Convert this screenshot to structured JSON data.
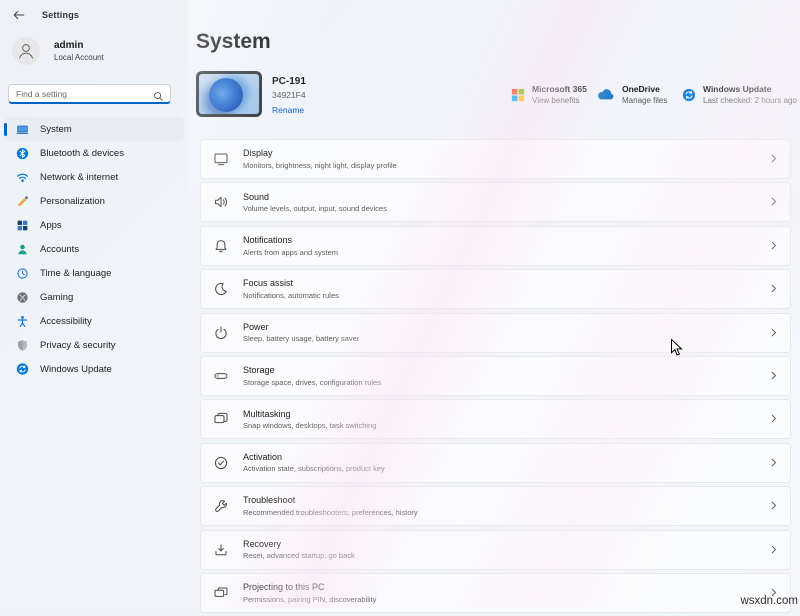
{
  "titlebar": {
    "title": "Settings",
    "back_icon": "back-arrow-icon"
  },
  "user": {
    "name": "admin",
    "type": "Local Account",
    "avatar_icon": "person-icon"
  },
  "search": {
    "placeholder": "Find a setting",
    "icon": "search-icon"
  },
  "sidebar": {
    "items": [
      {
        "id": "system",
        "label": "System",
        "icon": "system-icon",
        "selected": true
      },
      {
        "id": "bluetooth-devices",
        "label": "Bluetooth & devices",
        "icon": "bluetooth-icon",
        "selected": false
      },
      {
        "id": "network-internet",
        "label": "Network & internet",
        "icon": "network-icon",
        "selected": false
      },
      {
        "id": "personalization",
        "label": "Personalization",
        "icon": "personalization-icon",
        "selected": false
      },
      {
        "id": "apps",
        "label": "Apps",
        "icon": "apps-icon",
        "selected": false
      },
      {
        "id": "accounts",
        "label": "Accounts",
        "icon": "accounts-icon",
        "selected": false
      },
      {
        "id": "time-language",
        "label": "Time & language",
        "icon": "time-language-icon",
        "selected": false
      },
      {
        "id": "gaming",
        "label": "Gaming",
        "icon": "gaming-icon",
        "selected": false
      },
      {
        "id": "accessibility",
        "label": "Accessibility",
        "icon": "accessibility-icon",
        "selected": false
      },
      {
        "id": "privacy-security",
        "label": "Privacy & security",
        "icon": "privacy-security-icon",
        "selected": false
      },
      {
        "id": "windows-update",
        "label": "Windows Update",
        "icon": "windows-update-icon",
        "selected": false
      }
    ]
  },
  "page": {
    "title": "System"
  },
  "device": {
    "name": "PC-191",
    "id": "34921F4",
    "rename_label": "Rename"
  },
  "quick_links": [
    {
      "title": "Microsoft 365",
      "subtitle": "View benefits",
      "icon": "microsoft-365-icon"
    },
    {
      "title": "OneDrive",
      "subtitle": "Manage files",
      "icon": "onedrive-icon"
    },
    {
      "title": "Windows Update",
      "subtitle": "Last checked: 2 hours ago",
      "icon": "windows-update-icon"
    }
  ],
  "settings_rows": [
    {
      "id": "display",
      "title": "Display",
      "subtitle": "Monitors, brightness, night light, display profile",
      "icon": "display-icon"
    },
    {
      "id": "sound",
      "title": "Sound",
      "subtitle": "Volume levels, output, input, sound devices",
      "icon": "sound-icon"
    },
    {
      "id": "notifications",
      "title": "Notifications",
      "subtitle": "Alerts from apps and system",
      "icon": "notifications-icon"
    },
    {
      "id": "focus-assist",
      "title": "Focus assist",
      "subtitle": "Notifications, automatic rules",
      "icon": "focus-assist-icon"
    },
    {
      "id": "power",
      "title": "Power",
      "subtitle": "Sleep, battery usage, battery saver",
      "icon": "power-icon"
    },
    {
      "id": "storage",
      "title": "Storage",
      "subtitle": "Storage space, drives, configuration rules",
      "icon": "storage-icon"
    },
    {
      "id": "multitasking",
      "title": "Multitasking",
      "subtitle": "Snap windows, desktops, task switching",
      "icon": "multitasking-icon"
    },
    {
      "id": "activation",
      "title": "Activation",
      "subtitle": "Activation state, subscriptions, product key",
      "icon": "activation-icon"
    },
    {
      "id": "troubleshoot",
      "title": "Troubleshoot",
      "subtitle": "Recommended troubleshooters, preferences, history",
      "icon": "troubleshoot-icon"
    },
    {
      "id": "recovery",
      "title": "Recovery",
      "subtitle": "Reset, advanced startup, go back",
      "icon": "recovery-icon"
    },
    {
      "id": "projecting",
      "title": "Projecting to this PC",
      "subtitle": "Permissions, pairing PIN, discoverability",
      "icon": "projecting-icon"
    }
  ],
  "watermark": "wsxdn.com",
  "colors": {
    "accent": "#0067c0"
  }
}
